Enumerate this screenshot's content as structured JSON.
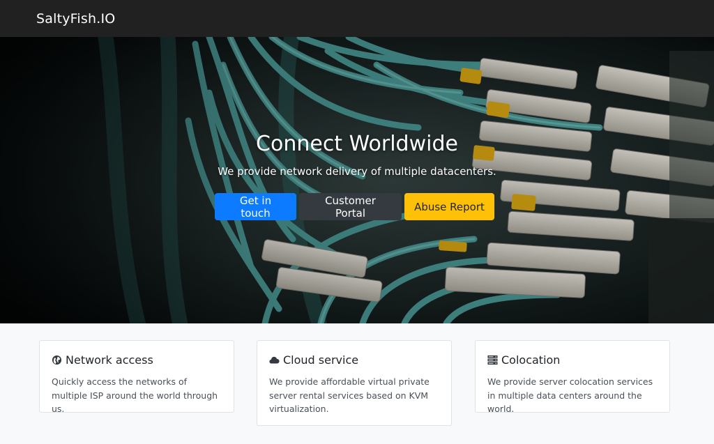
{
  "navbar": {
    "brand": "SaltyFish.IO"
  },
  "hero": {
    "title": "Connect Worldwide",
    "subtitle": "We provide network delivery of multiple datacenters.",
    "buttons": [
      {
        "label": "Get in touch",
        "color": "#0d7bff"
      },
      {
        "label": "Customer Portal",
        "color": "#343a40"
      },
      {
        "label": "Abuse Report",
        "color": "#ffc107"
      }
    ]
  },
  "cards": [
    {
      "icon": "globe-icon",
      "title": "Network access",
      "text": "Quickly access the networks of multiple ISP around the world through us."
    },
    {
      "icon": "cloud-icon",
      "title": "Cloud service",
      "text": "We provide affordable virtual private server rental services based on KVM virtualization."
    },
    {
      "icon": "server-icon",
      "title": "Colocation",
      "text": "We provide server colocation services in multiple data centers around the world."
    }
  ]
}
